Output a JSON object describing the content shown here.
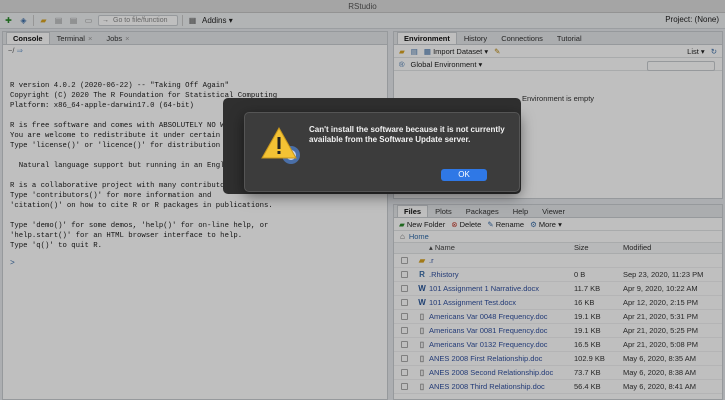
{
  "window_title": "RStudio",
  "toolbar": {
    "goto_placeholder": "Go to file/function",
    "addins_label": "Addins",
    "project_label": "Project: (None)"
  },
  "console_pane": {
    "tabs": [
      "Console",
      "Terminal",
      "Jobs"
    ],
    "path": "~/",
    "lines": [
      "R version 4.0.2 (2020-06-22) -- \"Taking Off Again\"",
      "Copyright (C) 2020 The R Foundation for Statistical Computing",
      "Platform: x86_64-apple-darwin17.0 (64-bit)",
      "",
      "R is free software and comes with ABSOLUTELY NO W",
      "You are welcome to redistribute it under certain",
      "Type 'license()' or 'licence()' for distribution",
      "",
      "  Natural language support but running in an Engl",
      "",
      "R is a collaborative project with many contributo",
      "Type 'contributors()' for more information and",
      "'citation()' on how to cite R or R packages in publications.",
      "",
      "Type 'demo()' for some demos, 'help()' for on-line help, or",
      "'help.start()' for an HTML browser interface to help.",
      "Type 'q()' to quit R."
    ],
    "prompt": ">"
  },
  "env_pane": {
    "tabs": [
      "Environment",
      "History",
      "Connections",
      "Tutorial"
    ],
    "import_label": "Import Dataset",
    "list_label": "List",
    "scope_label": "Global Environment",
    "empty_text": "Environment is empty"
  },
  "files_pane": {
    "tabs": [
      "Files",
      "Plots",
      "Packages",
      "Help",
      "Viewer"
    ],
    "new_folder": "New Folder",
    "delete": "Delete",
    "rename": "Rename",
    "more": "More",
    "breadcrumb": "Home",
    "headers": {
      "name": "Name",
      "size": "Size",
      "modified": "Modified"
    },
    "rows": [
      {
        "name": ".r",
        "size": "",
        "modified": "",
        "icon": "folder"
      },
      {
        "name": ".Rhistory",
        "size": "0 B",
        "modified": "Sep 23, 2020, 11:23 PM",
        "icon": "r-file"
      },
      {
        "name": "101 Assignment 1 Narrative.docx",
        "size": "11.7 KB",
        "modified": "Apr 9, 2020, 10:22 AM",
        "icon": "word"
      },
      {
        "name": "101 Assignment Test.docx",
        "size": "16 KB",
        "modified": "Apr 12, 2020, 2:15 PM",
        "icon": "word"
      },
      {
        "name": "Americans Var 0048 Frequency.doc",
        "size": "19.1 KB",
        "modified": "Apr 21, 2020, 5:31 PM",
        "icon": "doc"
      },
      {
        "name": "Americans Var 0081 Frequency.doc",
        "size": "19.1 KB",
        "modified": "Apr 21, 2020, 5:25 PM",
        "icon": "doc"
      },
      {
        "name": "Americans Var 0132 Frequency.doc",
        "size": "16.5 KB",
        "modified": "Apr 21, 2020, 5:08 PM",
        "icon": "doc"
      },
      {
        "name": "ANES 2008 First Relationship.doc",
        "size": "102.9 KB",
        "modified": "May 6, 2020, 8:35 AM",
        "icon": "doc"
      },
      {
        "name": "ANES 2008 Second Relationship.doc",
        "size": "73.7 KB",
        "modified": "May 6, 2020, 8:38 AM",
        "icon": "doc"
      },
      {
        "name": "ANES 2008 Third Relationship.doc",
        "size": "56.4 KB",
        "modified": "May 6, 2020, 8:41 AM",
        "icon": "doc"
      }
    ]
  },
  "dialog": {
    "message": "Can't install the software because it is not currently available from the Software Update server.",
    "ok_label": "OK",
    "icon": "warning-icon"
  }
}
